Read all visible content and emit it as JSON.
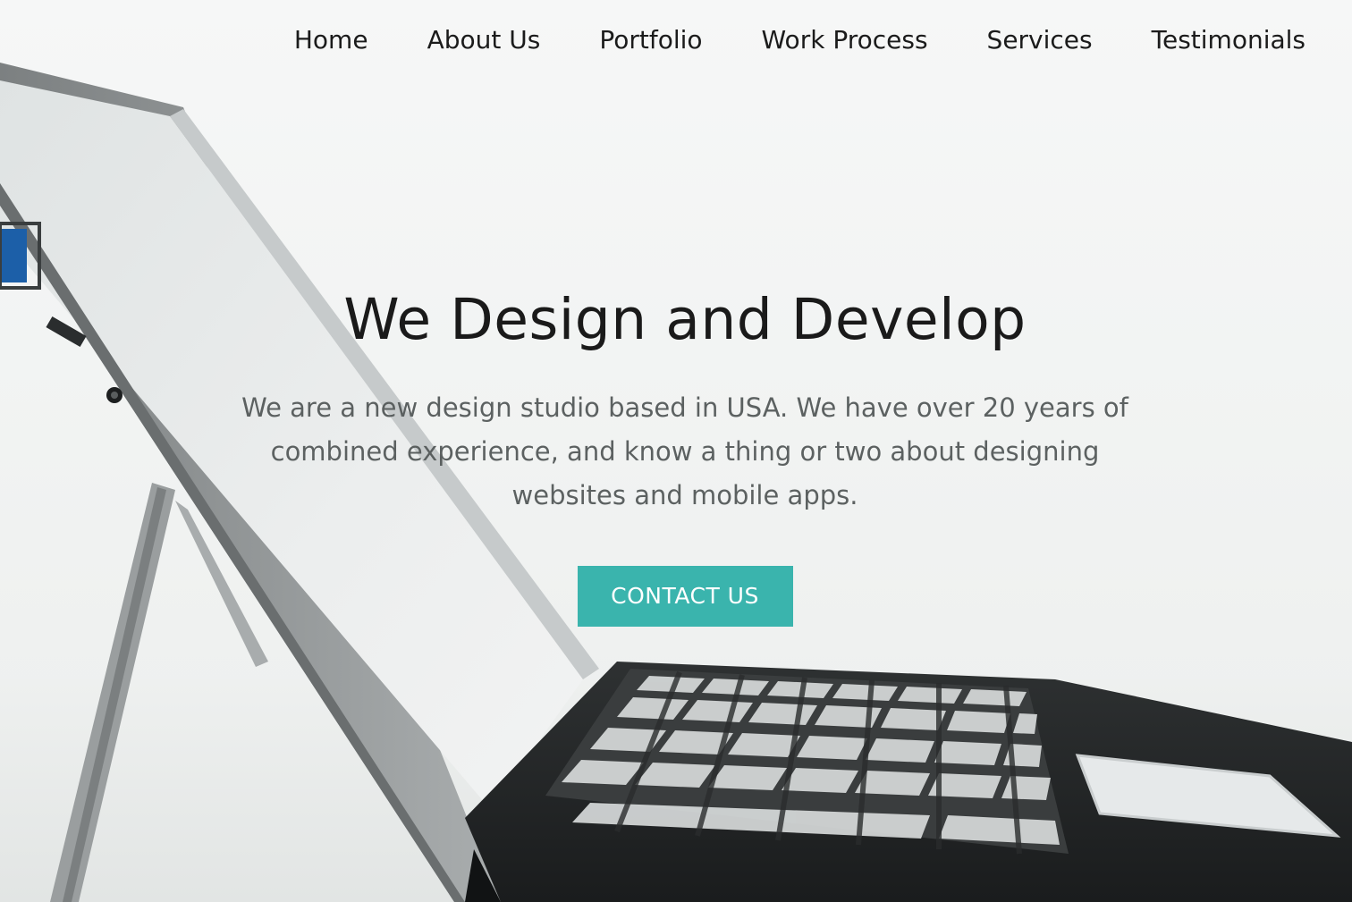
{
  "nav": {
    "items": [
      {
        "label": "Home"
      },
      {
        "label": "About Us"
      },
      {
        "label": "Portfolio"
      },
      {
        "label": "Work Process"
      },
      {
        "label": "Services"
      },
      {
        "label": "Testimonials"
      }
    ]
  },
  "hero": {
    "title": "We Design and Develop",
    "description": "We are a new design studio based in USA. We have over 20 years of combined experience, and know a thing or two about designing websites and mobile apps.",
    "cta_label": "CONTACT US"
  },
  "colors": {
    "accent": "#3ab4ad",
    "text_dark": "#1a1a1a",
    "text_muted": "#555a5a"
  }
}
